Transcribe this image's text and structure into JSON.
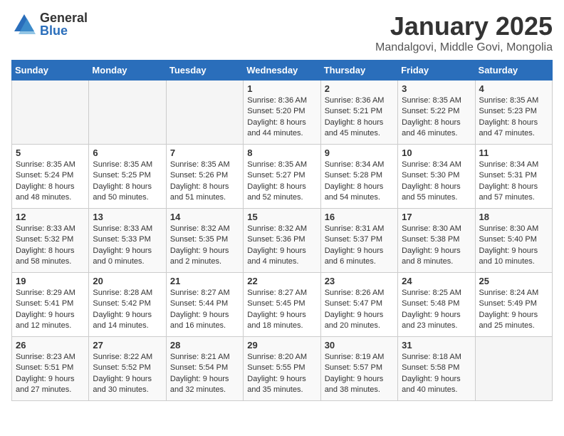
{
  "header": {
    "logo_general": "General",
    "logo_blue": "Blue",
    "month": "January 2025",
    "location": "Mandalgovi, Middle Govi, Mongolia"
  },
  "weekdays": [
    "Sunday",
    "Monday",
    "Tuesday",
    "Wednesday",
    "Thursday",
    "Friday",
    "Saturday"
  ],
  "weeks": [
    [
      {
        "day": "",
        "info": ""
      },
      {
        "day": "",
        "info": ""
      },
      {
        "day": "",
        "info": ""
      },
      {
        "day": "1",
        "info": "Sunrise: 8:36 AM\nSunset: 5:20 PM\nDaylight: 8 hours and 44 minutes."
      },
      {
        "day": "2",
        "info": "Sunrise: 8:36 AM\nSunset: 5:21 PM\nDaylight: 8 hours and 45 minutes."
      },
      {
        "day": "3",
        "info": "Sunrise: 8:35 AM\nSunset: 5:22 PM\nDaylight: 8 hours and 46 minutes."
      },
      {
        "day": "4",
        "info": "Sunrise: 8:35 AM\nSunset: 5:23 PM\nDaylight: 8 hours and 47 minutes."
      }
    ],
    [
      {
        "day": "5",
        "info": "Sunrise: 8:35 AM\nSunset: 5:24 PM\nDaylight: 8 hours and 48 minutes."
      },
      {
        "day": "6",
        "info": "Sunrise: 8:35 AM\nSunset: 5:25 PM\nDaylight: 8 hours and 50 minutes."
      },
      {
        "day": "7",
        "info": "Sunrise: 8:35 AM\nSunset: 5:26 PM\nDaylight: 8 hours and 51 minutes."
      },
      {
        "day": "8",
        "info": "Sunrise: 8:35 AM\nSunset: 5:27 PM\nDaylight: 8 hours and 52 minutes."
      },
      {
        "day": "9",
        "info": "Sunrise: 8:34 AM\nSunset: 5:28 PM\nDaylight: 8 hours and 54 minutes."
      },
      {
        "day": "10",
        "info": "Sunrise: 8:34 AM\nSunset: 5:30 PM\nDaylight: 8 hours and 55 minutes."
      },
      {
        "day": "11",
        "info": "Sunrise: 8:34 AM\nSunset: 5:31 PM\nDaylight: 8 hours and 57 minutes."
      }
    ],
    [
      {
        "day": "12",
        "info": "Sunrise: 8:33 AM\nSunset: 5:32 PM\nDaylight: 8 hours and 58 minutes."
      },
      {
        "day": "13",
        "info": "Sunrise: 8:33 AM\nSunset: 5:33 PM\nDaylight: 9 hours and 0 minutes."
      },
      {
        "day": "14",
        "info": "Sunrise: 8:32 AM\nSunset: 5:35 PM\nDaylight: 9 hours and 2 minutes."
      },
      {
        "day": "15",
        "info": "Sunrise: 8:32 AM\nSunset: 5:36 PM\nDaylight: 9 hours and 4 minutes."
      },
      {
        "day": "16",
        "info": "Sunrise: 8:31 AM\nSunset: 5:37 PM\nDaylight: 9 hours and 6 minutes."
      },
      {
        "day": "17",
        "info": "Sunrise: 8:30 AM\nSunset: 5:38 PM\nDaylight: 9 hours and 8 minutes."
      },
      {
        "day": "18",
        "info": "Sunrise: 8:30 AM\nSunset: 5:40 PM\nDaylight: 9 hours and 10 minutes."
      }
    ],
    [
      {
        "day": "19",
        "info": "Sunrise: 8:29 AM\nSunset: 5:41 PM\nDaylight: 9 hours and 12 minutes."
      },
      {
        "day": "20",
        "info": "Sunrise: 8:28 AM\nSunset: 5:42 PM\nDaylight: 9 hours and 14 minutes."
      },
      {
        "day": "21",
        "info": "Sunrise: 8:27 AM\nSunset: 5:44 PM\nDaylight: 9 hours and 16 minutes."
      },
      {
        "day": "22",
        "info": "Sunrise: 8:27 AM\nSunset: 5:45 PM\nDaylight: 9 hours and 18 minutes."
      },
      {
        "day": "23",
        "info": "Sunrise: 8:26 AM\nSunset: 5:47 PM\nDaylight: 9 hours and 20 minutes."
      },
      {
        "day": "24",
        "info": "Sunrise: 8:25 AM\nSunset: 5:48 PM\nDaylight: 9 hours and 23 minutes."
      },
      {
        "day": "25",
        "info": "Sunrise: 8:24 AM\nSunset: 5:49 PM\nDaylight: 9 hours and 25 minutes."
      }
    ],
    [
      {
        "day": "26",
        "info": "Sunrise: 8:23 AM\nSunset: 5:51 PM\nDaylight: 9 hours and 27 minutes."
      },
      {
        "day": "27",
        "info": "Sunrise: 8:22 AM\nSunset: 5:52 PM\nDaylight: 9 hours and 30 minutes."
      },
      {
        "day": "28",
        "info": "Sunrise: 8:21 AM\nSunset: 5:54 PM\nDaylight: 9 hours and 32 minutes."
      },
      {
        "day": "29",
        "info": "Sunrise: 8:20 AM\nSunset: 5:55 PM\nDaylight: 9 hours and 35 minutes."
      },
      {
        "day": "30",
        "info": "Sunrise: 8:19 AM\nSunset: 5:57 PM\nDaylight: 9 hours and 38 minutes."
      },
      {
        "day": "31",
        "info": "Sunrise: 8:18 AM\nSunset: 5:58 PM\nDaylight: 9 hours and 40 minutes."
      },
      {
        "day": "",
        "info": ""
      }
    ]
  ]
}
